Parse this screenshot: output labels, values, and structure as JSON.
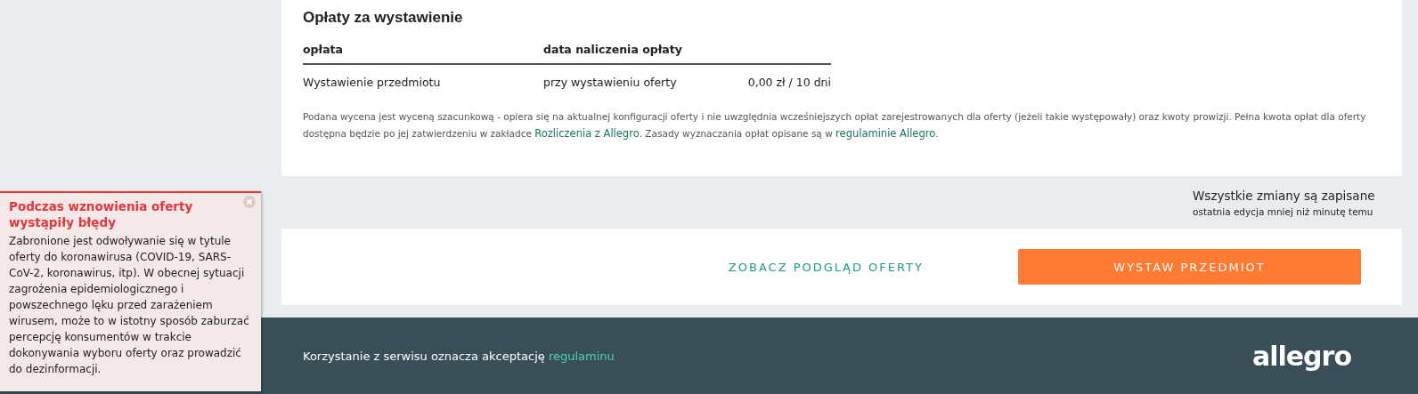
{
  "fees": {
    "title": "Opłaty za wystawienie",
    "columns": [
      "opłata",
      "data naliczenia opłaty"
    ],
    "rows": [
      {
        "name": "Wystawienie przedmiotu",
        "when": "przy wystawieniu oferty",
        "amount": "0,00 zł / 10 dni"
      }
    ],
    "note": [
      {
        "kind": "text",
        "text": "Podana wycena jest wyceną szacunkową - opiera się na aktualnej konfiguracji oferty i nie uwzględnia wcześniejszych opłat zarejestrowanych dla oferty (jeżeli takie występowały) oraz kwoty prowizji. Pełna kwota opłat dla oferty dostępna będzie po jej zatwierdzeniu w zakładce "
      },
      {
        "kind": "link",
        "text": "Rozliczenia z Allegro"
      },
      {
        "kind": "text",
        "text": ". Zasady wyznaczania opłat opisane są w "
      },
      {
        "kind": "link",
        "text": "regulaminie Allegro"
      },
      {
        "kind": "text",
        "text": "."
      }
    ]
  },
  "save_status": {
    "title": "Wszystkie zmiany są zapisane",
    "subtitle": "ostatnia edycja mniej niż minutę temu"
  },
  "actions": {
    "preview": "ZOBACZ PODGLĄD OFERTY",
    "submit": "WYSTAW PRZEDMIOT"
  },
  "footer": {
    "text": "Korzystanie z serwisu oznacza akceptację ",
    "link": "regulaminu",
    "logo": "allegro"
  },
  "toast": {
    "title": "Podczas wznowienia oferty wystąpiły błędy",
    "message": "Zabronione jest odwoływanie się w tytule oferty do koronawirusa (COVID-19, SARS-CoV-2, koronawirus, itp). W obecnej sytuacji zagrożenia epidemiologicznego i powszechnego lęku przed zarażeniem wirusem, może to w istotny sposób zaburzać percepcję konsumentów w trakcie dokonywania wyboru oferty oraz prowadzić do dezinformacji."
  }
}
